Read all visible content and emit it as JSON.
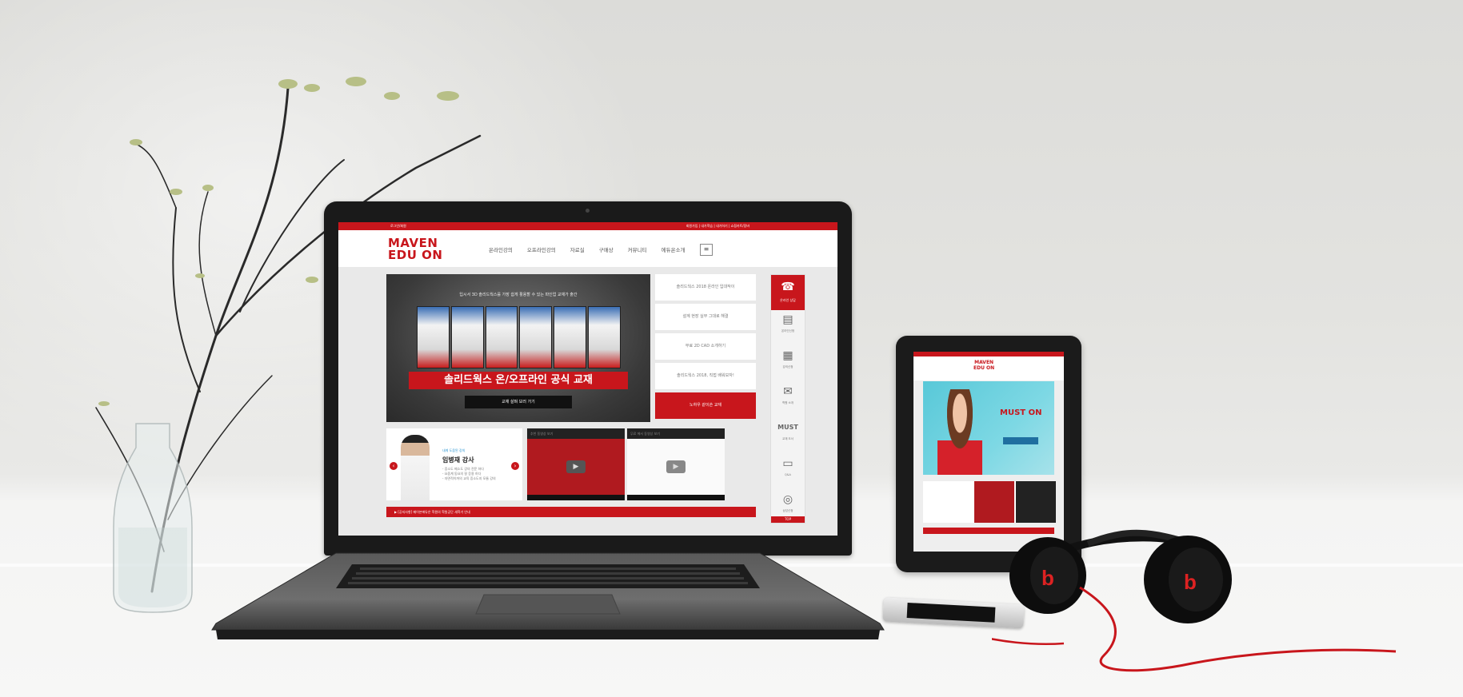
{
  "image": {
    "type": "photo",
    "scene": "Laptop, tablet, smartphone and headphones on a white desk next to a vase with branches, displaying the MAVEN EDU ON website"
  },
  "laptop_site": {
    "topbar_left": "로그인/회원",
    "topbar_right": "회원가입 | 내가학습 | 내가하기 | 쇼핑카트/장바",
    "logo_line1": "MAVEN",
    "logo_line2": "EDU ON",
    "menu": [
      "온라인강의",
      "오프라인강의",
      "자료실",
      "구매상",
      "커뮤니티",
      "에듀온소개"
    ],
    "menu_icon": "≡",
    "banner": {
      "subtitle": "입시서 3D 솔리드웍스를 가장 쉽게 활용할 수 있는 파인업 교재가 출간",
      "title": "솔리드웍스 온/오프라인 공식 교재",
      "button": "교재 살펴 보러 가기"
    },
    "side_links": [
      "솔리드웍스 2018 온라인 입대작이",
      "설계 현장 실무 그대로 해결",
      "무료 2D CAD 소개하기",
      "솔리드웍스 2018, 직접 배워보자!",
      "노하우 같이쓴 교재"
    ],
    "teacher": {
      "small": "내게 도움된 강의",
      "name": "임병재 강사",
      "desc": [
        "- 증소도 메소도 강의 전문 하다",
        "- 요즘계 동요의 잘 응용 하다",
        "- 자면적이까의 교육 증소도지 모듈 강의"
      ]
    },
    "videos": [
      "추천 동영상 보기",
      "무료 에서 동영상 보기"
    ],
    "marquee": "▶ [공지사항] 메이븐에듀온 학원의 학원공단 새학기 안내",
    "quick_menu": [
      {
        "icon": "✉",
        "label": "온라인신청"
      },
      {
        "icon": "▤",
        "label": "강의신청"
      },
      {
        "icon": "▦",
        "label": "자료실"
      },
      {
        "icon": "✉",
        "label": "학원 소개"
      },
      {
        "icon": "MUST",
        "label": "교재 도서"
      },
      {
        "icon": "▭",
        "label": "Q&A"
      },
      {
        "icon": "◎",
        "label": "상담신청"
      }
    ],
    "quick_top_label": "온라인 상담",
    "quick_bottom": "TOP"
  },
  "tablet_site": {
    "logo_line1": "MAVEN",
    "logo_line2": "EDU ON",
    "hero_title": "MUST ON"
  },
  "colors": {
    "brand_red": "#c8161c",
    "wall": "#e3e3e0"
  }
}
